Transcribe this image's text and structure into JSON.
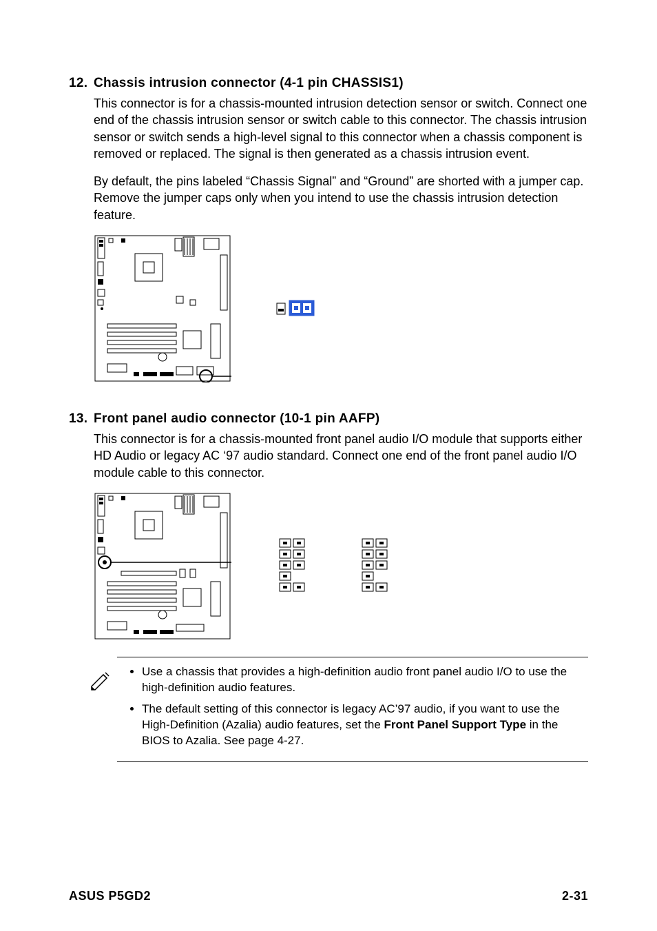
{
  "section12": {
    "number": "12.",
    "title": "Chassis intrusion connector (4-1 pin CHASSIS1)",
    "para1": "This connector is for a chassis-mounted intrusion detection sensor or switch. Connect one end of the chassis intrusion sensor or switch cable to this connector. The chassis intrusion sensor or switch sends a high-level signal to this connector when a chassis component is removed or replaced. The signal is then generated as a chassis intrusion event.",
    "para2": "By default, the pins labeled “Chassis Signal” and “Ground” are shorted with a jumper cap. Remove the jumper caps only when you intend to use the chassis intrusion detection feature."
  },
  "section13": {
    "number": "13.",
    "title": "Front panel audio connector (10-1 pin AAFP)",
    "para1": "This connector is for a chassis-mounted front panel audio I/O module that supports either HD Audio or legacy AC ‘97 audio standard. Connect one end of the front panel audio I/O module cable to this connector."
  },
  "notes": {
    "item1": "Use a chassis that provides a high-definition audio front panel audio I/O to use the high-definition audio features.",
    "item2_a": "The default setting of this connector is legacy AC’97 audio, if you want to use the High-Definition (Azalia) audio features, set the ",
    "item2_bold": "Front Panel Support Type",
    "item2_b": " in the BIOS to Azalia. See page 4-27."
  },
  "footer": {
    "left": "ASUS P5GD2",
    "right": "2-31"
  }
}
